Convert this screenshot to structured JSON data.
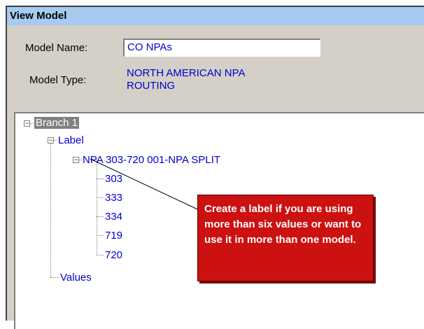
{
  "window": {
    "title": "View Model"
  },
  "form": {
    "model_name_label": "Model Name:",
    "model_name_value": "CO NPAs",
    "model_type_label": "Model Type:",
    "model_type_value_line1": "NORTH AMERICAN NPA",
    "model_type_value_line2": "ROUTING"
  },
  "tree": {
    "root": "Branch 1",
    "label_node": "Label",
    "npa_node": "NPA 303-720 001-NPA SPLIT",
    "values": [
      "303",
      "333",
      "334",
      "719",
      "720"
    ],
    "values_node": "Values"
  },
  "callout": {
    "text": "Create a label if you are using more than six values or want to use it in more than one model."
  },
  "colors": {
    "titlebar": "#a6caf0",
    "panel": "#d4d0c8",
    "link_blue": "#0000cc",
    "callout_red": "#cc1111"
  }
}
